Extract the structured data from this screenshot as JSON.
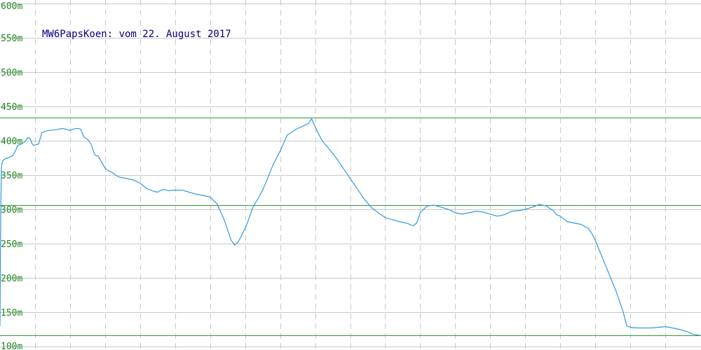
{
  "chart_data": {
    "type": "line",
    "title": "MW6PapsKoen: vom 22. August 2017",
    "xlabel": "",
    "ylabel": "",
    "ylim": [
      100,
      600
    ],
    "xlim": [
      0,
      1000
    ],
    "y_ticks": [
      100,
      150,
      200,
      250,
      300,
      350,
      400,
      450,
      500,
      550,
      600
    ],
    "y_tick_labels": [
      "100m",
      "150m",
      "200m",
      "250m",
      "300m",
      "350m",
      "400m",
      "450m",
      "500m",
      "550m",
      "600m"
    ],
    "x_grid": [
      50,
      100,
      150,
      200,
      250,
      300,
      350,
      400,
      450,
      500,
      550,
      600,
      650,
      700,
      750,
      800,
      850,
      900,
      950
    ],
    "grid": true,
    "reference_lines": [
      {
        "value": 434,
        "color": "#339933"
      },
      {
        "value": 306,
        "color": "#339933"
      },
      {
        "value": 116,
        "color": "#339933"
      }
    ],
    "series": [
      {
        "color": "#3399dd",
        "x": [
          0,
          1,
          2,
          3,
          5,
          8,
          12,
          18,
          22,
          25,
          30,
          35,
          40,
          43,
          46,
          48,
          50,
          55,
          60,
          63,
          65,
          70,
          80,
          90,
          100,
          105,
          110,
          115,
          120,
          125,
          130,
          135,
          138,
          140,
          150,
          155,
          160,
          165,
          170,
          180,
          190,
          200,
          210,
          220,
          225,
          230,
          235,
          240,
          250,
          260,
          270,
          280,
          290,
          300,
          310,
          320,
          325,
          330,
          335,
          340,
          345,
          350,
          355,
          360,
          365,
          370,
          375,
          380,
          390,
          400,
          410,
          420,
          425,
          430,
          440,
          445,
          450,
          455,
          460,
          465,
          470,
          480,
          490,
          500,
          510,
          520,
          530,
          540,
          550,
          560,
          570,
          580,
          585,
          590,
          595,
          600,
          610,
          620,
          630,
          640,
          650,
          660,
          670,
          680,
          690,
          700,
          710,
          720,
          730,
          740,
          750,
          760,
          765,
          770,
          780,
          790,
          795,
          800,
          810,
          820,
          830,
          840,
          845,
          850,
          860,
          870,
          880,
          890,
          895,
          900,
          910,
          920,
          930,
          940,
          950,
          960,
          970,
          980,
          990,
          1000
        ],
        "values": [
          130,
          290,
          360,
          368,
          372,
          374,
          375,
          378,
          385,
          393,
          395,
          398,
          405,
          403,
          395,
          393,
          394,
          395,
          412,
          413,
          414,
          415,
          416,
          418,
          415,
          417,
          418,
          417,
          405,
          402,
          395,
          380,
          378,
          378,
          360,
          356,
          354,
          350,
          347,
          345,
          343,
          338,
          330,
          326,
          325,
          328,
          329,
          327,
          328,
          328,
          325,
          322,
          320,
          318,
          308,
          285,
          270,
          255,
          248,
          252,
          262,
          272,
          285,
          300,
          310,
          318,
          328,
          340,
          365,
          385,
          408,
          415,
          418,
          420,
          425,
          432,
          420,
          410,
          400,
          394,
          388,
          375,
          360,
          345,
          330,
          315,
          303,
          295,
          288,
          285,
          282,
          280,
          278,
          276,
          280,
          295,
          305,
          306,
          303,
          300,
          295,
          293,
          295,
          297,
          296,
          293,
          290,
          292,
          297,
          298,
          300,
          303,
          305,
          307,
          305,
          298,
          292,
          290,
          282,
          280,
          278,
          272,
          265,
          255,
          230,
          205,
          180,
          150,
          130,
          128,
          127,
          127,
          127,
          128,
          129,
          127,
          125,
          122,
          118,
          116
        ]
      }
    ]
  }
}
